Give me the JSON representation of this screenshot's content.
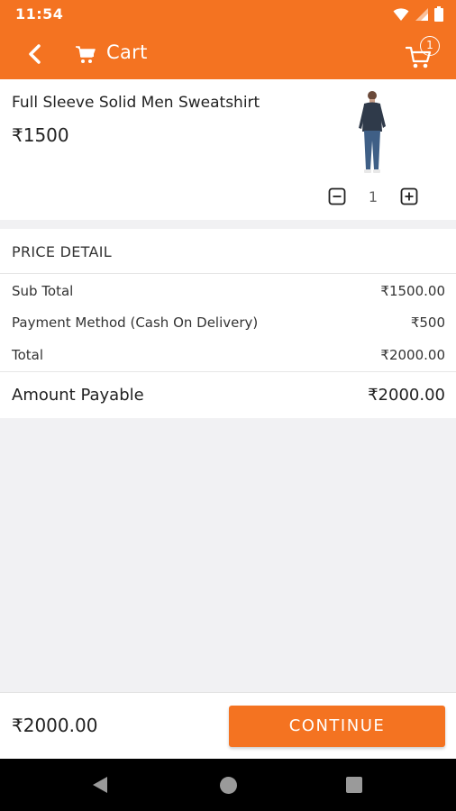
{
  "status_bar": {
    "time": "11:54"
  },
  "app_bar": {
    "title": "Cart",
    "cart_count": "1"
  },
  "product": {
    "name": "Full Sleeve Solid Men Sweatshirt",
    "price": "₹1500",
    "quantity": "1"
  },
  "price_detail": {
    "header": "PRICE DETAIL",
    "rows": [
      {
        "label": "Sub Total",
        "value": "₹1500.00"
      },
      {
        "label": "Payment Method (Cash On Delivery)",
        "value": "₹500"
      },
      {
        "label": "Total",
        "value": "₹2000.00"
      }
    ],
    "payable_label": "Amount Payable",
    "payable_value": "₹2000.00"
  },
  "bottom_bar": {
    "total": "₹2000.00",
    "continue_label": "CONTINUE"
  },
  "colors": {
    "accent": "#f47321",
    "background": "#f1f1f3"
  },
  "icons": [
    "wifi-icon",
    "signal-icon",
    "battery-icon",
    "back-arrow-icon",
    "cart-icon",
    "minus-icon",
    "plus-icon",
    "nav-back-icon",
    "nav-home-icon",
    "nav-recent-icon"
  ]
}
